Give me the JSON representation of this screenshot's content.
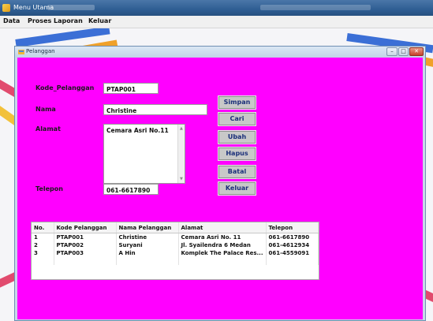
{
  "window": {
    "title": "Menu Utama"
  },
  "menubar": [
    "Data",
    "Proses",
    "Laporan",
    "Keluar"
  ],
  "form": {
    "title": "Pelanggan",
    "controls": {
      "minimize": "–",
      "maximize": "□",
      "close": "✕"
    },
    "fields": {
      "kode": {
        "label": "Kode_Pelanggan",
        "value": "PTAP001"
      },
      "nama": {
        "label": "Nama",
        "value": "Christine"
      },
      "alamat": {
        "label": "Alamat",
        "value": "Cemara Asri No.11"
      },
      "telepon": {
        "label": "Telepon",
        "value": "061-6617890"
      }
    },
    "buttons": [
      "Simpan",
      "Cari",
      "Ubah",
      "Hapus",
      "Batal",
      "Keluar"
    ],
    "table": {
      "columns": [
        "No.",
        "Kode Pelanggan",
        "Nama Pelanggan",
        "Alamat",
        "Telepon"
      ],
      "rows": [
        [
          "1",
          "PTAP001",
          "Christine",
          "Cemara Asri No. 11",
          "061-6617890"
        ],
        [
          "2",
          "PTAP002",
          "Suryani",
          "Jl. Syailendra 6 Medan",
          "061-4612934"
        ],
        [
          "3",
          "PTAP003",
          "A Hin",
          "Komplek The Palace Res...",
          "061-4559091"
        ]
      ]
    }
  },
  "colors": {
    "form_background": "#ff00ff",
    "button_text": "#1b2f7a"
  }
}
